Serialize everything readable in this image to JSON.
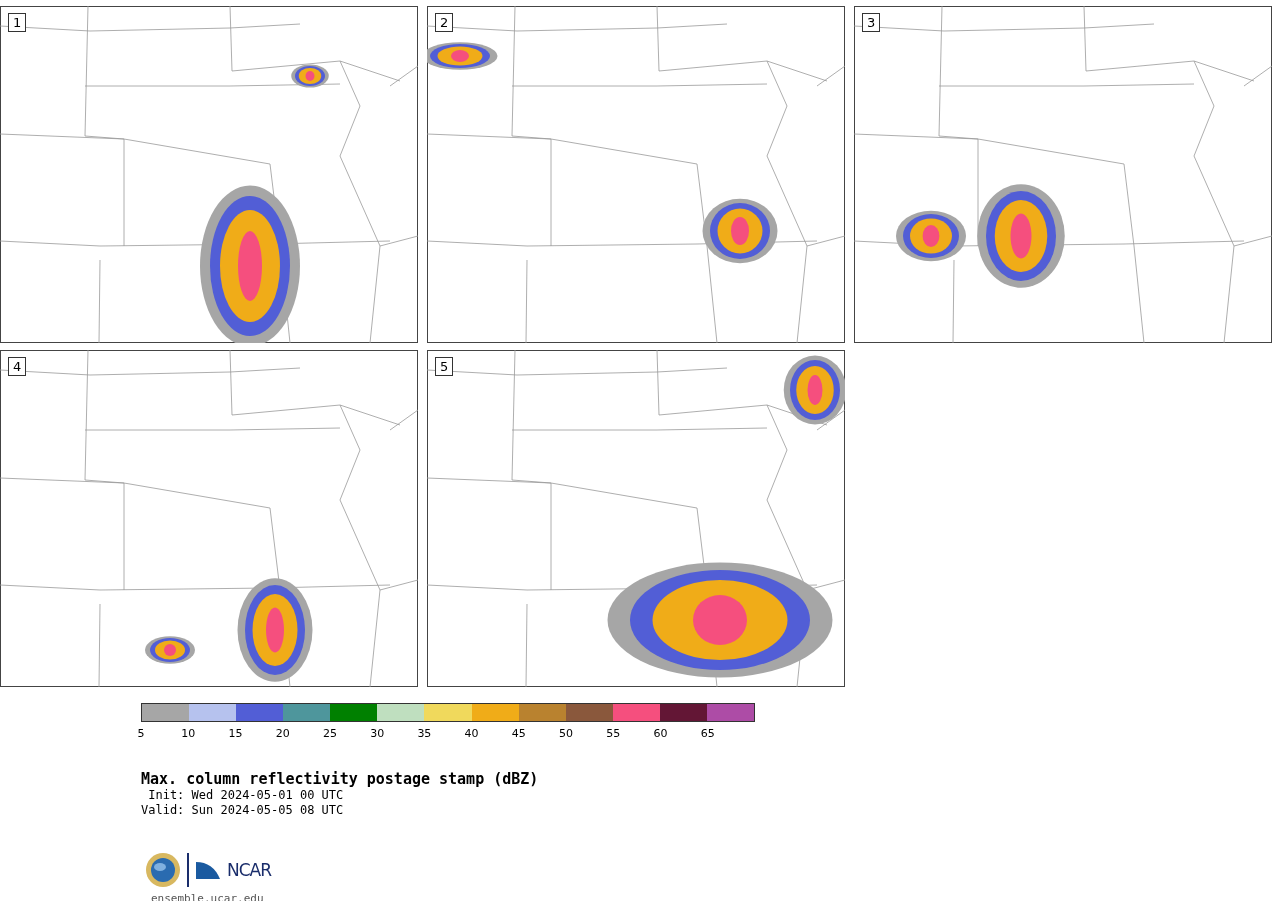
{
  "panels": [
    {
      "label": "1"
    },
    {
      "label": "2"
    },
    {
      "label": "3"
    },
    {
      "label": "4"
    },
    {
      "label": "5"
    }
  ],
  "colorbar": {
    "segments": [
      {
        "color": "#a6a6a6"
      },
      {
        "color": "#b6c2ee"
      },
      {
        "color": "#525ed6"
      },
      {
        "color": "#4e969c"
      },
      {
        "color": "#008000"
      },
      {
        "color": "#bfdfbf"
      },
      {
        "color": "#f0d95c"
      },
      {
        "color": "#f0ac18"
      },
      {
        "color": "#b9822f"
      },
      {
        "color": "#8a583c"
      },
      {
        "color": "#f54f7e"
      },
      {
        "color": "#631635"
      },
      {
        "color": "#ad4ca6"
      }
    ],
    "ticks": [
      "5",
      "10",
      "15",
      "20",
      "25",
      "30",
      "35",
      "40",
      "45",
      "50",
      "55",
      "60",
      "65"
    ]
  },
  "title": "Max. column reflectivity postage stamp (dBZ)",
  "init": " Init: Wed 2024-05-01 00 UTC",
  "valid": "Valid: Sun 2024-05-05 08 UTC",
  "logo": {
    "wordmark": "NCAR",
    "url": "ensemble.ucar.edu"
  }
}
